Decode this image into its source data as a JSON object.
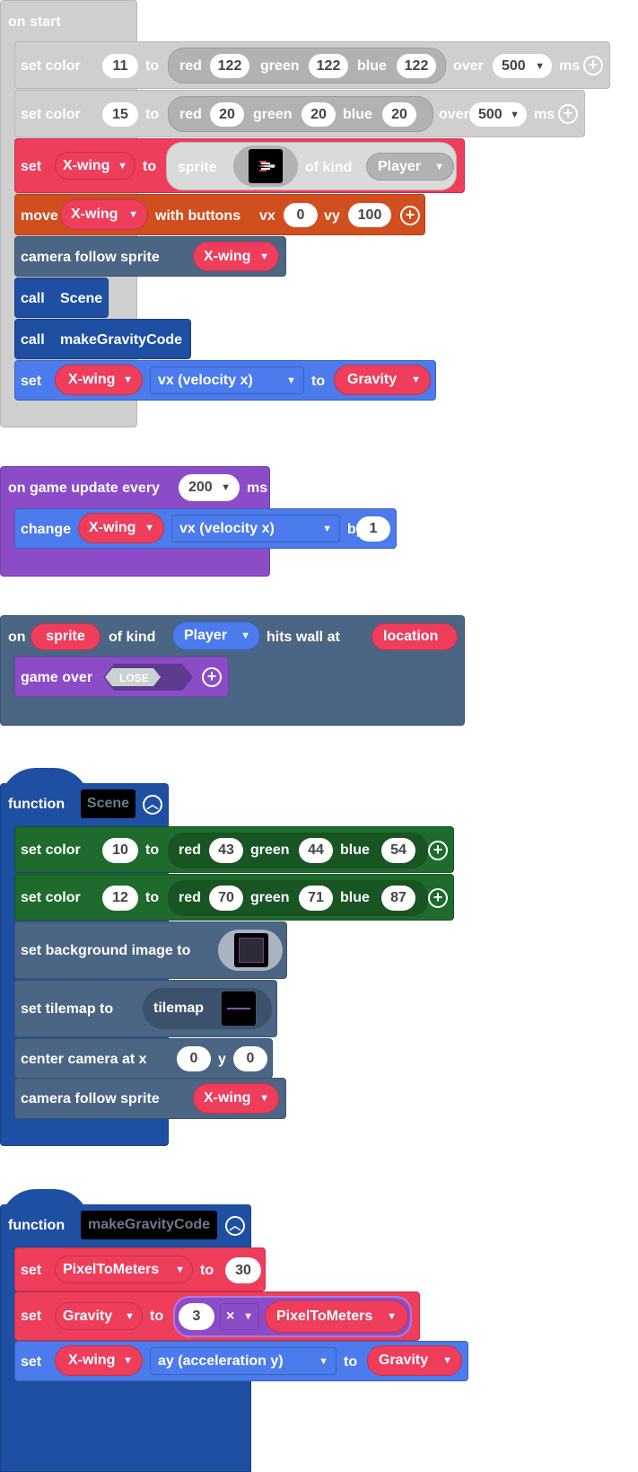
{
  "on_start": {
    "header": "on start",
    "set_color_1": {
      "label": "set color",
      "index": "11",
      "to": "to",
      "red_label": "red",
      "red": "122",
      "green_label": "green",
      "green": "122",
      "blue_label": "blue",
      "blue": "122",
      "over": "over",
      "ms_value": "500",
      "ms": "ms"
    },
    "set_color_2": {
      "label": "set color",
      "index": "15",
      "to": "to",
      "red_label": "red",
      "red": "20",
      "green_label": "green",
      "green": "20",
      "blue_label": "blue",
      "blue": "20",
      "over": "over",
      "ms_value": "500",
      "ms": "ms"
    },
    "set_sprite": {
      "set": "set",
      "var": "X-wing",
      "to": "to",
      "sprite": "sprite",
      "of_kind": "of kind",
      "kind": "Player"
    },
    "move": {
      "move": "move",
      "var": "X-wing",
      "with_buttons": "with buttons",
      "vx_label": "vx",
      "vx": "0",
      "vy_label": "vy",
      "vy": "100"
    },
    "camera": {
      "label": "camera follow sprite",
      "var": "X-wing"
    },
    "call_scene": {
      "call": "call",
      "name": "Scene"
    },
    "call_gravity": {
      "call": "call",
      "name": "makeGravityCode"
    },
    "set_vx": {
      "set": "set",
      "var": "X-wing",
      "prop": "vx (velocity x)",
      "to": "to",
      "value": "Gravity"
    }
  },
  "on_update": {
    "header": "on game update every",
    "interval": "200",
    "ms": "ms",
    "change": {
      "change": "change",
      "var": "X-wing",
      "prop": "vx (velocity x)",
      "by": "by",
      "value": "1"
    }
  },
  "on_hit_wall": {
    "on": "on",
    "sprite": "sprite",
    "of_kind": "of kind",
    "kind": "Player",
    "hits_wall_at": "hits wall at",
    "location": "location",
    "game_over": "game over",
    "result": "LOSE"
  },
  "function_scene": {
    "function": "function",
    "name": "Scene",
    "set_color_1": {
      "label": "set color",
      "index": "10",
      "to": "to",
      "red_label": "red",
      "red": "43",
      "green_label": "green",
      "green": "44",
      "blue_label": "blue",
      "blue": "54"
    },
    "set_color_2": {
      "label": "set color",
      "index": "12",
      "to": "to",
      "red_label": "red",
      "red": "70",
      "green_label": "green",
      "green": "71",
      "blue_label": "blue",
      "blue": "87"
    },
    "bg": "set background image to",
    "tilemap_label": "set tilemap to",
    "tilemap": "tilemap",
    "center": "center camera at x",
    "x": "0",
    "y_label": "y",
    "y": "0",
    "camera": "camera follow sprite",
    "camera_var": "X-wing"
  },
  "function_gravity": {
    "function": "function",
    "name": "makeGravityCode",
    "set1": {
      "set": "set",
      "var": "PixelToMeters",
      "to": "to",
      "value": "30"
    },
    "set2": {
      "set": "set",
      "var": "Gravity",
      "to": "to",
      "left": "3",
      "op": "×",
      "right": "PixelToMeters"
    },
    "set3": {
      "set": "set",
      "var": "X-wing",
      "prop": "ay (acceleration y)",
      "to": "to",
      "value": "Gravity"
    }
  },
  "colors": {
    "grey_event": "#cfcfcf",
    "sprites_red": "#ee3e5c",
    "controller_orange": "#d14e1f",
    "scene_slate": "#4b6584",
    "functions_blue": "#1e4fa3",
    "sprites_blue": "#4b7bec",
    "game_purple": "#8c4cc8",
    "music_green": "#1f6b2d"
  }
}
